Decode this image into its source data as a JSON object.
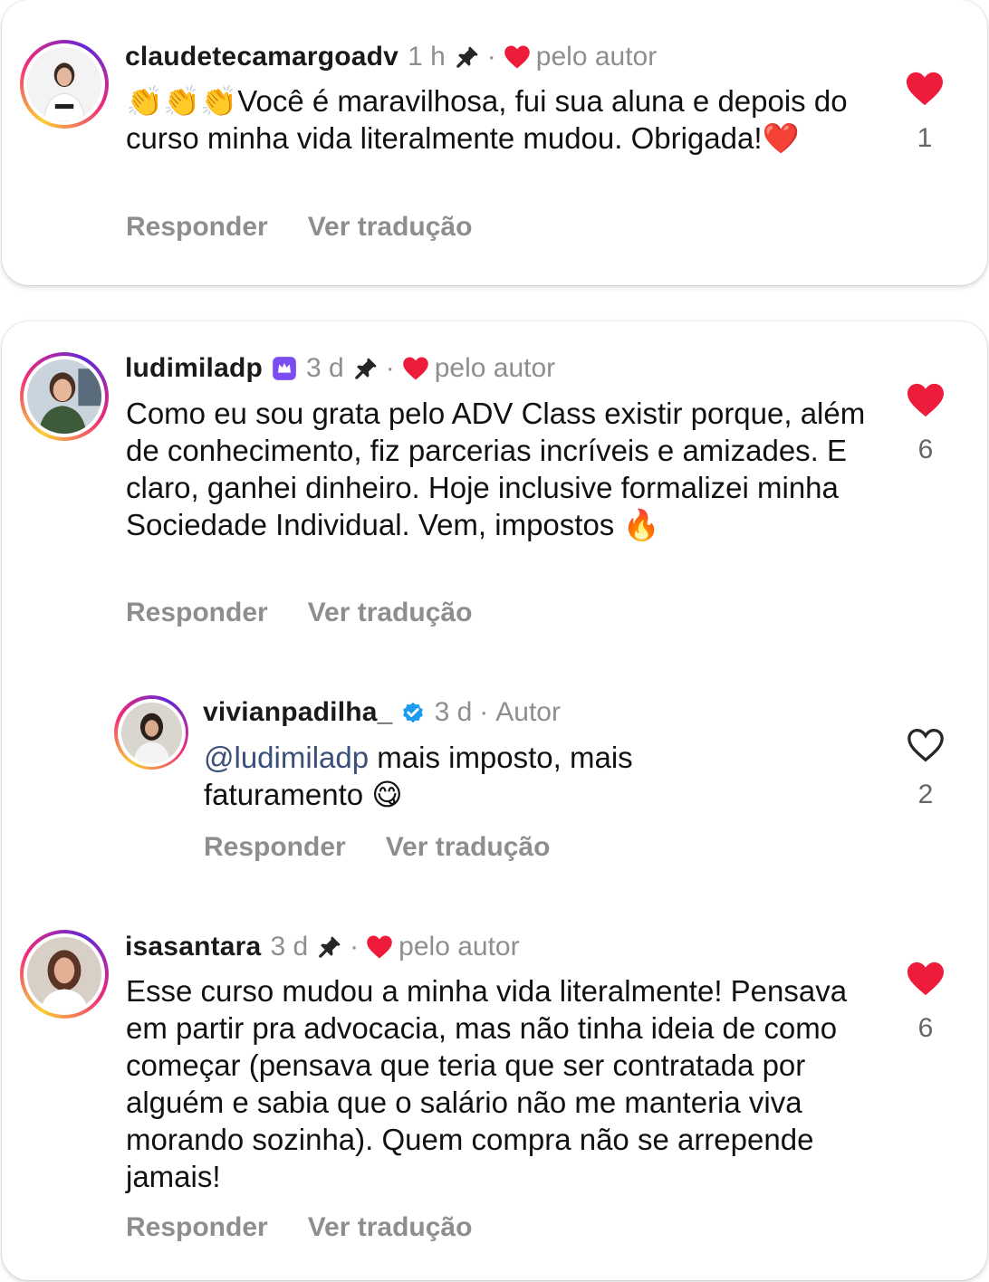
{
  "colors": {
    "heart_red": "#ed1c3b",
    "meta_gray": "#8e8e8e",
    "mention_blue": "#3a4f7a",
    "verified_blue": "#1d9bf0",
    "badge_purple": "#7b4cf0"
  },
  "comments": [
    {
      "username": "claudetecamargoadv",
      "time": "1 h",
      "by_author": "pelo autor",
      "text_emoji_prefix": "👏👏👏",
      "text": "Você é maravilhosa, fui sua aluna e depois do curso minha vida literalmente mudou. Obrigada!",
      "text_emoji_suffix": "❤️",
      "actions": {
        "reply": "Responder",
        "translate": "Ver tradução"
      },
      "likes": "1",
      "liked": true
    },
    {
      "username": "ludimiladp",
      "time": "3 d",
      "by_author": "pelo autor",
      "text": "Como eu sou grata pelo ADV Class existir porque, além de conhecimento, fiz parcerias incríveis e amizades. E claro, ganhei dinheiro. Hoje inclusive formalizei minha Sociedade Individual. Vem, impostos",
      "text_emoji_suffix": "🔥",
      "actions": {
        "reply": "Responder",
        "translate": "Ver tradução"
      },
      "likes": "6",
      "liked": true
    },
    {
      "username": "vivianpadilha_",
      "time": "3 d",
      "role": "Autor",
      "mention": "@ludimiladp",
      "text": "mais imposto, mais faturamento",
      "text_emoji_suffix": "😋",
      "actions": {
        "reply": "Responder",
        "translate": "Ver tradução"
      },
      "likes": "2",
      "liked": false
    },
    {
      "username": "isasantara",
      "time": "3 d",
      "by_author": "pelo autor",
      "text": "Esse curso mudou a minha vida literalmente! Pensava em partir pra advocacia, mas não tinha ideia de como começar (pensava que teria que ser contratada por alguém e sabia que o salário não me manteria viva morando sozinha). Quem compra não se arrepende jamais!",
      "actions": {
        "reply": "Responder",
        "translate": "Ver tradução"
      },
      "likes": "6",
      "liked": true
    }
  ]
}
